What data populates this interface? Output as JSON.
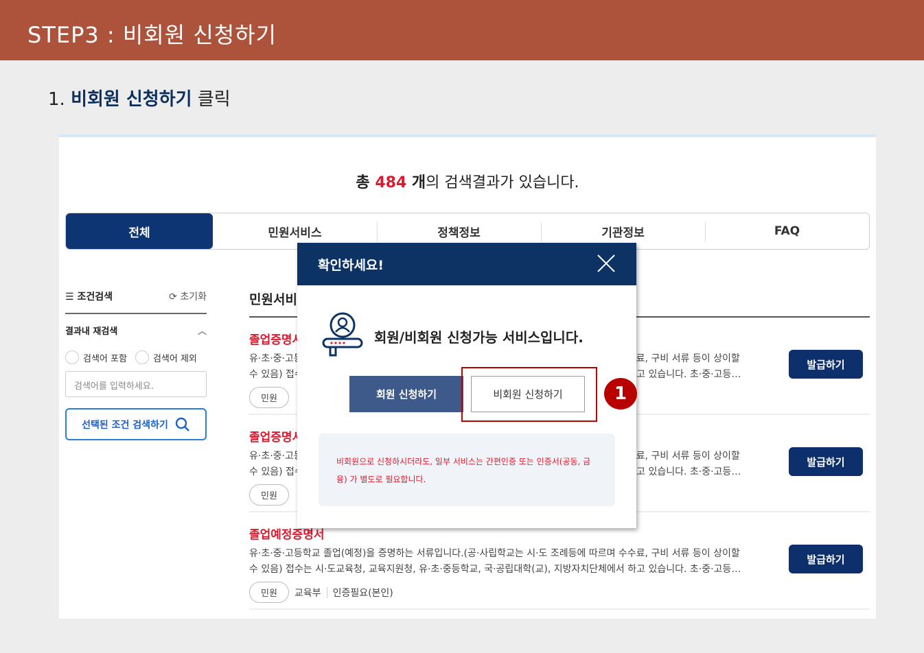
{
  "header": {
    "title": "STEP3 : 비회원 신청하기"
  },
  "instruction": {
    "prefix": "1. ",
    "bold": "비회원 신청하기",
    "suffix": " 클릭"
  },
  "results": {
    "count_pre": "총 ",
    "count": "484",
    "count_unit": " 개",
    "count_post": "의 검색결과가 있습니다."
  },
  "tabs": [
    {
      "label": "전체",
      "active": true
    },
    {
      "label": "민원서비스"
    },
    {
      "label": "정책정보"
    },
    {
      "label": "기관정보"
    },
    {
      "label": "FAQ"
    }
  ],
  "sidebar": {
    "title": "조건검색",
    "reset": "초기화",
    "subtitle": "결과내 재검색",
    "radio_include": "검색어 포함",
    "radio_exclude": "검색어 제외",
    "search_placeholder": "검색어를 입력하세요.",
    "search_button": "선택된 조건 검색하기"
  },
  "list": {
    "title": "민원서비스",
    "items": [
      {
        "title": "졸업증명서",
        "desc1": "유·초·중·고등학교 졸업(예정)을 증명하는 서류입니다.(공·사립학교는 시·도 조례등에 따르며 수수료, 구비 서류 등이 상이할",
        "desc2": "수 있음) 접수는 시·도교육청, 교육지원청, 유·초·중등학교, 국·공립대학(교), 지방자치단체에서 하고 있습니다. 초·중·고등…",
        "tag": "민원",
        "button": "발급하기"
      },
      {
        "title": "졸업증명서",
        "desc1": "유·초·중·고등학교 졸업(예정)을 증명하는 서류입니다.(공·사립학교는 시·도 조례등에 따르며 수수료, 구비 서류 등이 상이할",
        "desc2": "수 있음) 접수는 시·도교육청, 교육지원청, 유·초·중등학교, 국·공립대학(교), 지방자치단체에서 하고 있습니다. 초·중·고등…",
        "tag": "민원",
        "button": "발급하기"
      },
      {
        "title": "졸업예정증명서",
        "desc1": "유·초·중·고등학교 졸업(예정)을 증명하는 서류입니다.(공·사립학교는 시·도 조례등에 따르며 수수료, 구비 서류 등이 상이할",
        "desc2": "수 있음) 접수는 시·도교육청, 교육지원청, 유·초·중등학교, 국·공립대학(교), 지방자치단체에서 하고 있습니다. 초·중·고등…",
        "tag": "민원",
        "org": "교육부",
        "auth": "인증필요(본인)",
        "button": "발급하기"
      }
    ]
  },
  "modal": {
    "title": "확인하세요!",
    "message": "회원/비회원 신청가능 서비스입니다.",
    "member_button": "회원 신청하기",
    "nonmember_button": "비회원 신청하기",
    "note": "비회원으로 신청하시더라도, 일부 서비스는 간편인증 또는 인증서(공동, 금융) 가 별도로 필요합니다."
  },
  "annotation": {
    "step_number": "1"
  },
  "colors": {
    "header": "#ae533b",
    "navy": "#0d3364",
    "red": "#e0182d",
    "highlight": "#c00000"
  }
}
